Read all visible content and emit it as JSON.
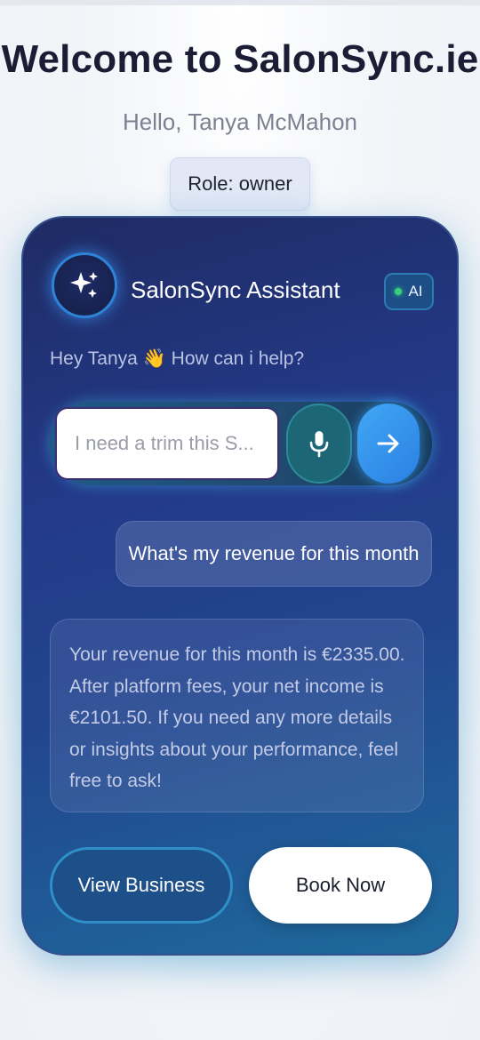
{
  "header": {
    "title": "Welcome to SalonSync.ie",
    "greeting": "Hello, Tanya McMahon",
    "role_badge": "Role: owner"
  },
  "assistant": {
    "name": "SalonSync Assistant",
    "badge_label": "AI",
    "prompt": "Hey Tanya 👋 How can i help?",
    "input_value": "I need a trim this S...",
    "icons": {
      "avatar": "sparkles-icon",
      "mic": "microphone-icon",
      "send": "arrow-right-icon"
    }
  },
  "conversation": {
    "user_message": "What's my revenue for this month",
    "assistant_message": "Your revenue for this month is €2335.00. After platform fees, your net income is €2101.50. If you need any more details or insights about your performance, feel free to ask!"
  },
  "actions": {
    "view_business": "View Business",
    "book_now": "Book Now"
  },
  "colors": {
    "card_gradient_start": "#1f2b63",
    "card_gradient_end": "#1e6a9c",
    "accent_blue": "#2b7fe3",
    "status_dot": "#3ad07a"
  }
}
